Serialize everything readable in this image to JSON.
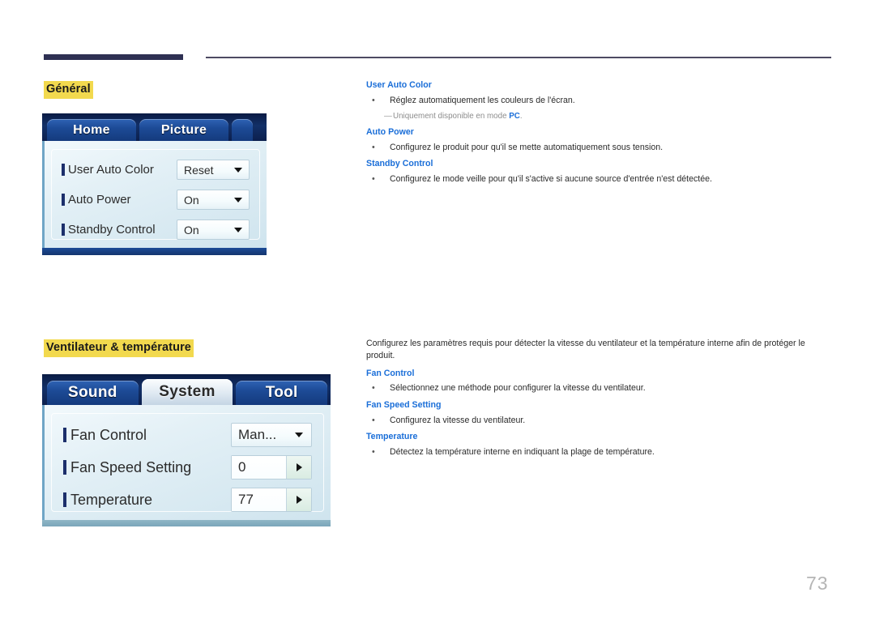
{
  "page": {
    "number": "73",
    "rule_color": "#2e3053",
    "highlight_color": "#f2d94e",
    "term_color": "#1a6ed8"
  },
  "sections": [
    {
      "heading": "Général",
      "osd": {
        "tabs": [
          {
            "label": "Home",
            "active": false
          },
          {
            "label": "Picture",
            "active": false
          },
          {
            "label": "",
            "active": false
          }
        ],
        "rows": [
          {
            "label": "User Auto Color",
            "value": "Reset",
            "control": "dropdown",
            "icon": "chevron-down-icon"
          },
          {
            "label": "Auto Power",
            "value": "On",
            "control": "dropdown",
            "icon": "chevron-down-icon"
          },
          {
            "label": "Standby Control",
            "value": "On",
            "control": "dropdown",
            "icon": "chevron-down-icon"
          }
        ]
      },
      "intro": "",
      "entries": [
        {
          "term": "User Auto Color",
          "bullet": "Réglez automatiquement les couleurs de l'écran.",
          "note_prefix": "Uniquement disponible en mode ",
          "note_emphasis": "PC",
          "note_suffix": "."
        },
        {
          "term": "Auto Power",
          "bullet": "Configurez le produit pour qu'il se mette automatiquement sous tension."
        },
        {
          "term": "Standby Control",
          "bullet": "Configurez le mode veille pour qu'il s'active si aucune source d'entrée n'est détectée."
        }
      ]
    },
    {
      "heading": "Ventilateur & température",
      "osd": {
        "tabs": [
          {
            "label": "Sound",
            "active": false
          },
          {
            "label": "System",
            "active": true
          },
          {
            "label": "Tool",
            "active": false
          }
        ],
        "rows": [
          {
            "label": "Fan Control",
            "value": "Man...",
            "control": "dropdown",
            "icon": "chevron-down-icon"
          },
          {
            "label": "Fan Speed Setting",
            "value": "0",
            "control": "stepper",
            "icon": "chevron-right-icon"
          },
          {
            "label": "Temperature",
            "value": "77",
            "control": "stepper",
            "icon": "chevron-right-icon"
          }
        ]
      },
      "intro": "Configurez les paramètres requis pour détecter la vitesse du ventilateur et la température interne afin de protéger le produit.",
      "entries": [
        {
          "term": "Fan Control",
          "bullet": "Sélectionnez une méthode pour configurer la vitesse du ventilateur."
        },
        {
          "term": "Fan Speed Setting",
          "bullet": "Configurez la vitesse du ventilateur."
        },
        {
          "term": "Temperature",
          "bullet": "Détectez la température interne en indiquant la plage de température."
        }
      ]
    }
  ],
  "bullet_glyph": "•"
}
